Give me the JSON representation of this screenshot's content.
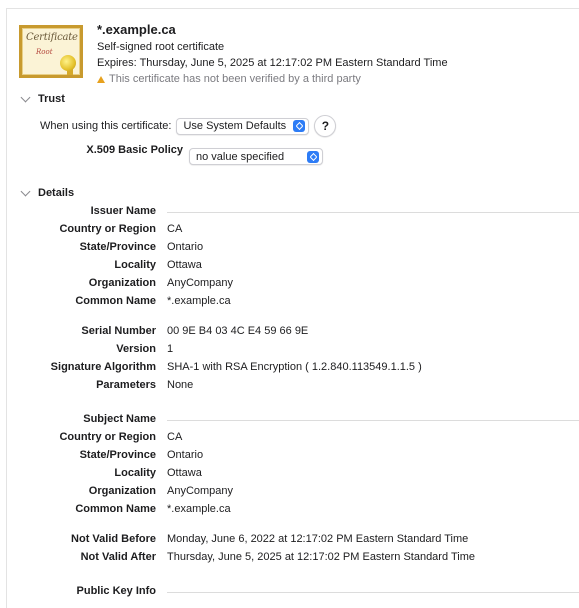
{
  "header": {
    "title": "*.example.ca",
    "subtitle": "Self-signed root certificate",
    "expires": "Expires: Thursday, June 5, 2025 at 12:17:02 PM Eastern Standard Time",
    "warning": "This certificate has not been verified by a third party",
    "icon_text_1": "Certificate",
    "icon_text_2": "Root"
  },
  "trust": {
    "heading": "Trust",
    "when_using_label": "When using this certificate:",
    "when_using_value": "Use System Defaults",
    "help": "?",
    "x509_label": "X.509 Basic Policy",
    "x509_value": "no value specified"
  },
  "details": {
    "heading": "Details",
    "issuer": {
      "heading": "Issuer Name",
      "rows": [
        {
          "label": "Country or Region",
          "value": "CA"
        },
        {
          "label": "State/Province",
          "value": "Ontario"
        },
        {
          "label": "Locality",
          "value": "Ottawa"
        },
        {
          "label": "Organization",
          "value": "AnyCompany"
        },
        {
          "label": "Common Name",
          "value": "*.example.ca"
        }
      ]
    },
    "general": [
      {
        "label": "Serial Number",
        "value": "00 9E B4 03 4C E4 59 66 9E"
      },
      {
        "label": "Version",
        "value": "1"
      },
      {
        "label": "Signature Algorithm",
        "value": "SHA-1 with RSA Encryption ( 1.2.840.113549.1.1.5 )"
      },
      {
        "label": "Parameters",
        "value": "None"
      }
    ],
    "subject": {
      "heading": "Subject Name",
      "rows": [
        {
          "label": "Country or Region",
          "value": "CA"
        },
        {
          "label": "State/Province",
          "value": "Ontario"
        },
        {
          "label": "Locality",
          "value": "Ottawa"
        },
        {
          "label": "Organization",
          "value": "AnyCompany"
        },
        {
          "label": "Common Name",
          "value": "*.example.ca"
        }
      ]
    },
    "validity": [
      {
        "label": "Not Valid Before",
        "value": "Monday, June 6, 2022 at 12:17:02 PM Eastern Standard Time"
      },
      {
        "label": "Not Valid After",
        "value": "Thursday, June 5, 2025 at 12:17:02 PM Eastern Standard Time"
      }
    ],
    "public_key_heading": "Public Key Info"
  },
  "colors": {
    "accent": "#2d7cf6",
    "warning": "#e7a11e",
    "icon_border": "#c89a2e"
  }
}
